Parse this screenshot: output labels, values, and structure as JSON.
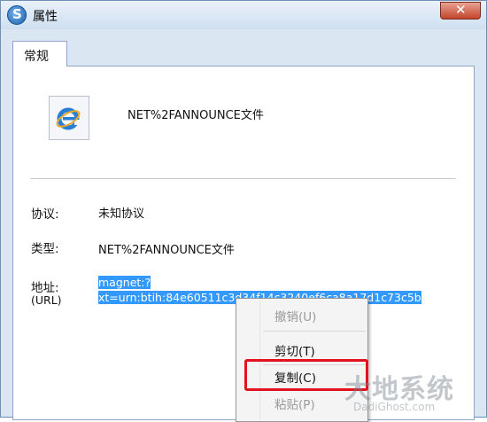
{
  "window": {
    "title": "属性",
    "close_glyph": "✕"
  },
  "tabs": [
    {
      "label": "常规"
    }
  ],
  "file": {
    "name": "NET%2FANNOUNCE文件",
    "icon": "internet-explorer-icon"
  },
  "fields": {
    "protocol": {
      "label": "协议:",
      "value": "未知协议"
    },
    "type": {
      "label": "类型:",
      "value": "NET%2FANNOUNCE文件"
    },
    "address": {
      "label": "地址:",
      "sublabel": "(URL)",
      "line1": "magnet:?",
      "line2": "xt=urn:btih:84e60511c3d34f14c3240ef6ca8a17d1c73c5b"
    }
  },
  "context_menu": {
    "items": [
      {
        "label": "撤销(U)",
        "enabled": false
      },
      {
        "label": "剪切(T)",
        "enabled": true
      },
      {
        "label": "复制(C)",
        "enabled": true,
        "highlighted": true
      },
      {
        "label": "粘贴(P)",
        "enabled": false
      }
    ]
  },
  "watermark": {
    "brand": "大地系统",
    "url": "DadiGhost.com"
  },
  "colors": {
    "selection": "#3399ff",
    "highlight_box": "#e3101e",
    "window_frame": "#dbe6f3"
  }
}
